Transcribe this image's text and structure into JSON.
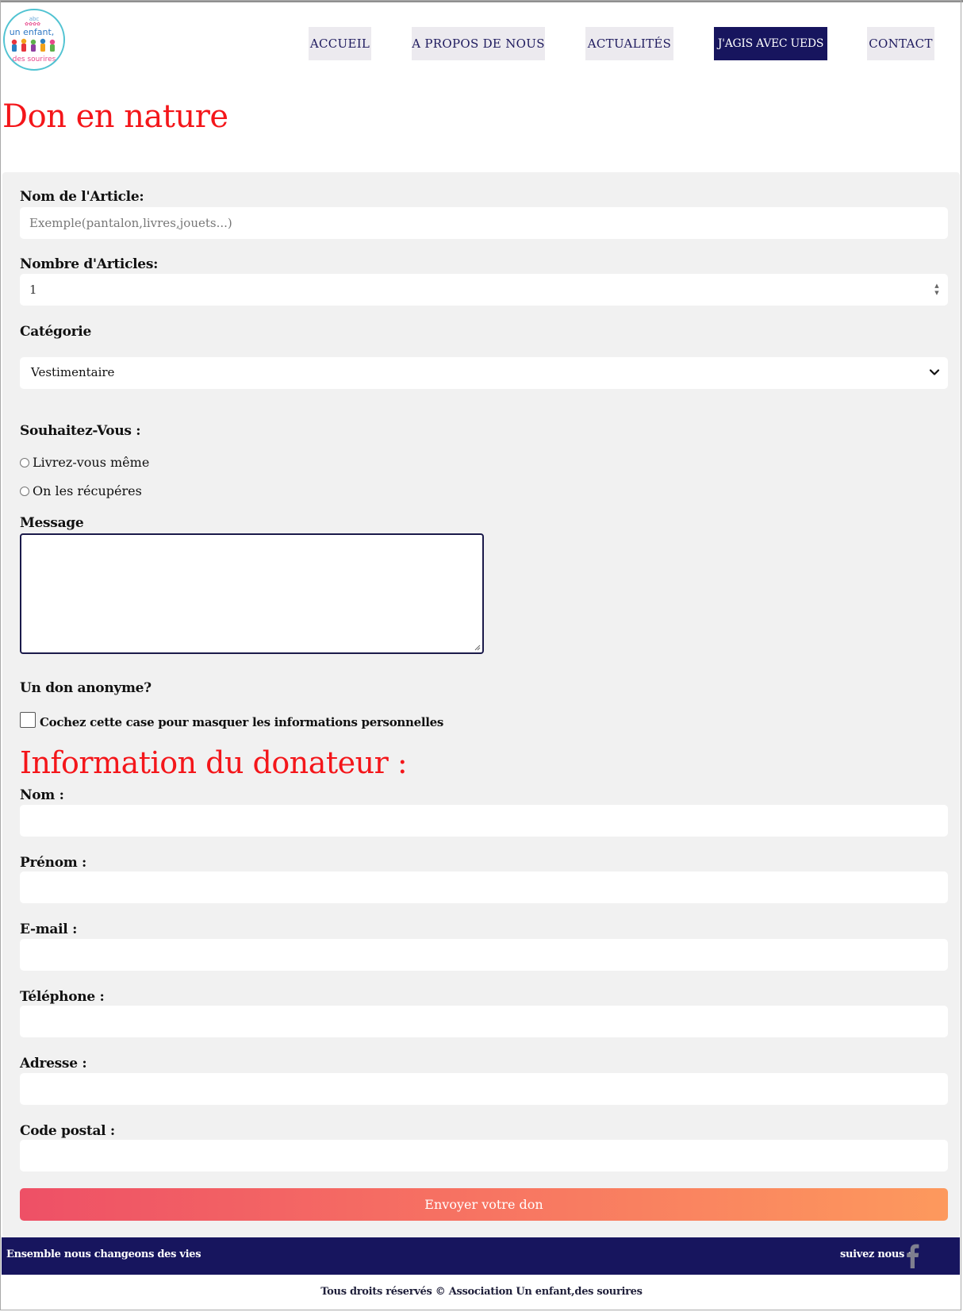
{
  "header": {
    "logo": {
      "lines": [
        "abc",
        "un enfant,",
        "des sourires"
      ],
      "colors": {
        "ring": "#51c3d2",
        "text": "#e8478b"
      }
    },
    "nav": [
      {
        "label": "ACCUEIL",
        "active": false
      },
      {
        "label": "A PROPOS DE NOUS",
        "active": false
      },
      {
        "label": "ACTUALITÉS",
        "active": false
      },
      {
        "label": "J'AGIS AVEC UEDS",
        "active": true
      },
      {
        "label": "CONTACT",
        "active": false
      }
    ]
  },
  "page": {
    "title": "Don en nature"
  },
  "form": {
    "article_name": {
      "label": "Nom de l'Article:",
      "placeholder": "Exemple(pantalon,livres,jouets...)",
      "value": ""
    },
    "article_count": {
      "label": "Nombre d'Articles:",
      "value": "1"
    },
    "category": {
      "label": "Catégorie",
      "selected": "Vestimentaire"
    },
    "delivery": {
      "label": "Souhaitez-Vous :",
      "options": [
        "Livrez-vous même",
        "On les récupéres"
      ]
    },
    "message": {
      "label": "Message",
      "value": ""
    },
    "anonymous": {
      "label": "Un don anonyme?",
      "checkbox_label": "Cochez cette case pour masquer les informations personnelles",
      "checked": false
    },
    "donor_section_title": "Information du donateur :",
    "donor_fields": {
      "nom": "Nom :",
      "prenom": "Prénom :",
      "email": "E-mail :",
      "telephone": "Téléphone :",
      "adresse": "Adresse :",
      "code_postal": "Code postal :"
    },
    "submit_label": "Envoyer votre don"
  },
  "footer": {
    "tagline": "Ensemble nous changeons des vies",
    "follow": "suivez nous :",
    "social_icon": "facebook-icon",
    "copyright": "Tous droits réservés © Association Un enfant,des sourires"
  },
  "colors": {
    "navy": "#17155e",
    "title_red": "#f4161a",
    "panel_bg": "#f1f1f1",
    "gradient_start": "#ee5066",
    "gradient_end": "#fd995d"
  }
}
